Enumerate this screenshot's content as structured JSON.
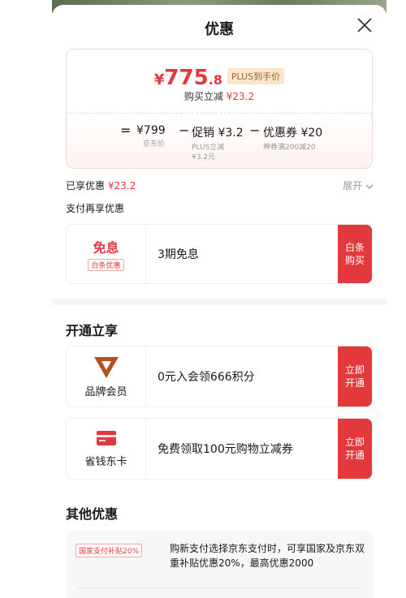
{
  "sheet": {
    "title": "优惠"
  },
  "price": {
    "symbol": "¥",
    "integer": "775",
    "decimal": ".8",
    "plus_tag": "PLUS到手价",
    "reduce_label": "购买立减",
    "reduce_value": "¥23.2"
  },
  "formula": {
    "equals": "=",
    "minus": "−",
    "base_main": "¥799",
    "base_sub": "京东价",
    "promo_main": "促销 ¥3.2",
    "promo_sub1": "PLUS立减",
    "promo_sub2": "¥3.2元",
    "coupon_main": "优惠券 ¥20",
    "coupon_sub": "神券满200减20"
  },
  "enjoyed": {
    "label": "已享优惠",
    "value": "¥23.2",
    "expand_label": "展开"
  },
  "pay_section": {
    "label": "支付再享优惠"
  },
  "installment": {
    "title": "免息",
    "tag": "白条优惠",
    "desc": "3期免息",
    "button": "白条购买"
  },
  "open_section": {
    "title": "开通立享"
  },
  "brand_member": {
    "logo": "V",
    "label": "品牌会员",
    "desc": "0元入会领666积分",
    "button": "立即开通"
  },
  "saver_card": {
    "label": "省钱东卡",
    "desc": "免费领取100元购物立减券",
    "button": "立即开通"
  },
  "other_section": {
    "title": "其他优惠"
  },
  "subsidy": {
    "tag": "国家支付补贴20%",
    "text": "购新支付选择京东支付时，可享国家及京东双重补贴优惠20%，最高优惠2000"
  },
  "colors": {
    "accent": "#e4393c",
    "plus_gold": "#fbe6c9",
    "vip_brown": "#b64f1f"
  }
}
